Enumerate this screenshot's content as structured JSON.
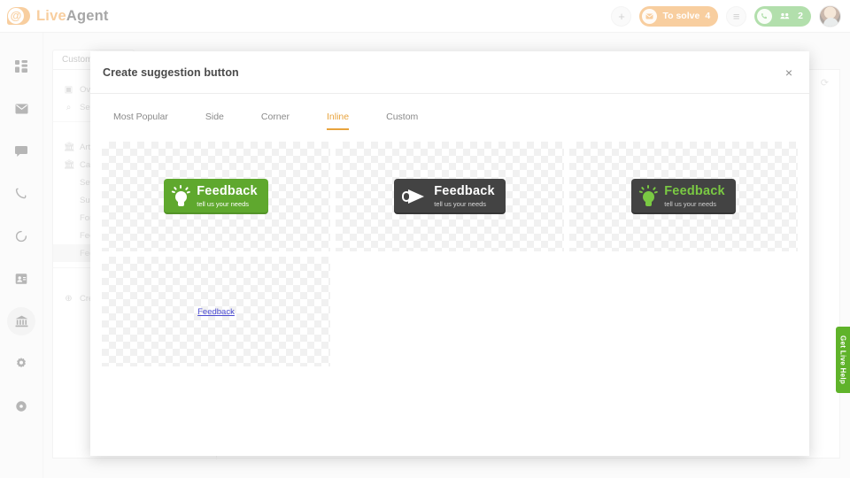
{
  "app": {
    "brand_live": "Live",
    "brand_agent": "Agent",
    "logo_glyph": "@"
  },
  "header": {
    "add_button": "+",
    "to_solve": {
      "label": "To solve",
      "count": "4",
      "icon": "envelope-icon"
    },
    "notes_button": "≡",
    "calls": {
      "count": "2",
      "phone_icon": "phone-icon",
      "people_icon": "people-icon"
    },
    "avatar_alt": "user-avatar"
  },
  "sidebar": {
    "items": [
      {
        "name": "dashboard",
        "icon": "grid-icon",
        "active": false
      },
      {
        "name": "tickets",
        "icon": "envelope-icon",
        "active": false
      },
      {
        "name": "chats",
        "icon": "chat-bubble-icon",
        "active": false
      },
      {
        "name": "calls",
        "icon": "phone-icon",
        "active": false
      },
      {
        "name": "history",
        "icon": "clock-icon",
        "active": false
      },
      {
        "name": "contacts",
        "icon": "contact-card-icon",
        "active": false
      },
      {
        "name": "customer-portal",
        "icon": "bank-icon",
        "active": true
      },
      {
        "name": "configuration",
        "icon": "gear-icon",
        "active": false
      },
      {
        "name": "help",
        "icon": "help-circle-icon",
        "active": false
      }
    ]
  },
  "background": {
    "tabs": [
      "Customer portal"
    ],
    "side_items": [
      {
        "icon": "image-icon",
        "label": "Overview"
      },
      {
        "icon": "search-icon",
        "label": "Search"
      },
      {
        "icon": "bank-icon",
        "label": "Articles"
      },
      {
        "icon": "bank-icon",
        "label": "Categories"
      },
      {
        "icon": "",
        "label": "Settings"
      },
      {
        "icon": "",
        "label": "Suggestions"
      },
      {
        "icon": "",
        "label": "Forums"
      },
      {
        "icon": "",
        "label": "Feedback"
      },
      {
        "icon": "",
        "label": "Feedback buttons"
      }
    ],
    "add_row": {
      "icon": "plus-circle-icon",
      "label": "Create"
    }
  },
  "modal": {
    "title": "Create suggestion button",
    "close_label": "×",
    "tabs": [
      {
        "label": "Most Popular",
        "active": false
      },
      {
        "label": "Side",
        "active": false
      },
      {
        "label": "Corner",
        "active": false
      },
      {
        "label": "Inline",
        "active": true
      },
      {
        "label": "Custom",
        "active": false
      }
    ],
    "options": [
      {
        "style": "green-bulb",
        "icon": "lightbulb-icon",
        "title": "Feedback",
        "subtitle": "tell us your needs",
        "bg_color": "#5fa82e",
        "title_color": "#ffffff"
      },
      {
        "style": "dark-megaphone",
        "icon": "megaphone-icon",
        "title": "Feedback",
        "subtitle": "tell us your needs",
        "bg_color": "#434343",
        "title_color": "#ffffff"
      },
      {
        "style": "dark-green-bulb",
        "icon": "lightbulb-icon",
        "title": "Feedback",
        "subtitle": "tell us your needs",
        "bg_color": "#434343",
        "title_color": "#7ac943"
      },
      {
        "style": "plain-link",
        "icon": "none",
        "title": "Feedback",
        "subtitle": "",
        "bg_color": "transparent",
        "title_color": "#4a4ad1"
      }
    ]
  },
  "live_help": {
    "label": "Get Live Help",
    "color": "#5fb32a"
  }
}
